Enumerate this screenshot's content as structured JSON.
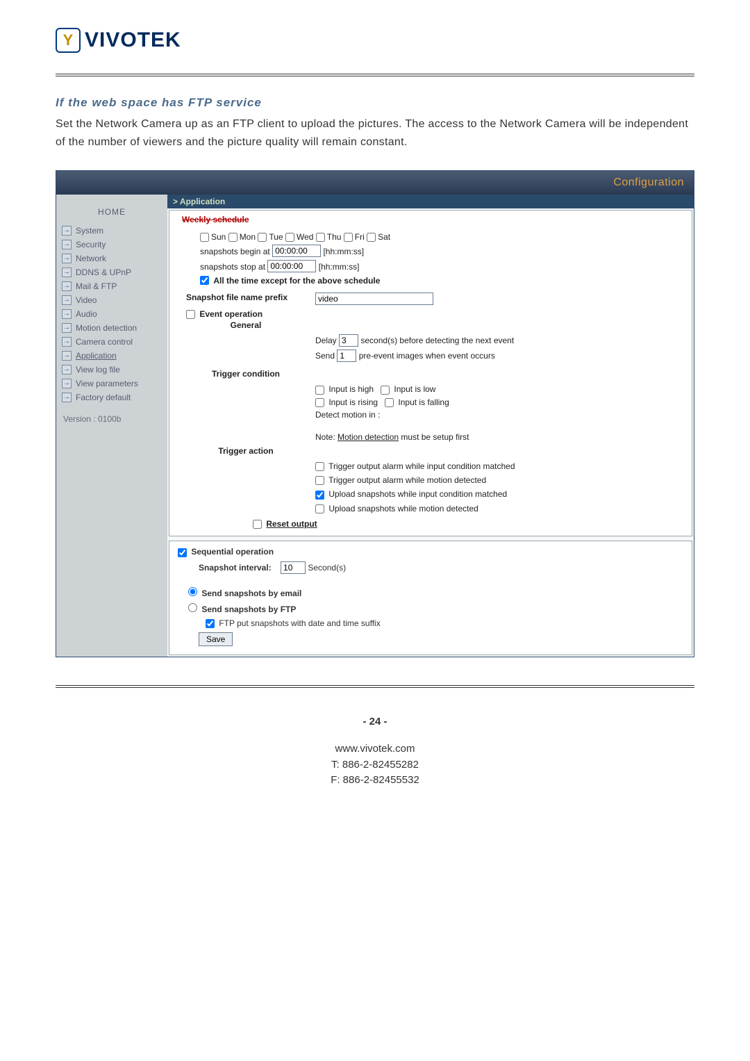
{
  "logo_text": "VIVOTEK",
  "section_title": "If the web space has FTP service",
  "intro": "Set the Network Camera up as an FTP client to upload the pictures. The access to the Network Camera will be independent of the number of viewers and the picture quality will remain constant.",
  "panel_header": "Configuration",
  "sidebar": {
    "home": "HOME",
    "items": [
      "System",
      "Security",
      "Network",
      "DDNS & UPnP",
      "Mail & FTP",
      "Video",
      "Audio",
      "Motion detection",
      "Camera control",
      "Application",
      "View log file",
      "View parameters",
      "Factory default"
    ],
    "active_index": 9,
    "version": "Version : 0100b"
  },
  "breadcrumb": "> Application",
  "schedule": {
    "legend": "Weekly schedule",
    "days": [
      "Sun",
      "Mon",
      "Tue",
      "Wed",
      "Thu",
      "Fri",
      "Sat"
    ],
    "begin_label": "snapshots begin at",
    "begin_value": "00:00:00",
    "stop_label": "snapshots stop at",
    "stop_value": "00:00:00",
    "hint": "[hh:mm:ss]",
    "all_time": "All the time except for the above schedule"
  },
  "prefix": {
    "label": "Snapshot file name prefix",
    "value": "video"
  },
  "event": {
    "label": "Event operation",
    "general": "General",
    "delay_label": "Delay",
    "delay_value": "3",
    "delay_after": "second(s) before detecting the next event",
    "send_label": "Send",
    "send_value": "1",
    "send_after": "pre-event images when event occurs",
    "trigger_cond": "Trigger condition",
    "input_high": "Input is high",
    "input_low": "Input is low",
    "input_rising": "Input is rising",
    "input_falling": "Input is falling",
    "detect_motion": "Detect motion in :",
    "note_pre": "Note: ",
    "note_link": "Motion detection",
    "note_post": " must be setup first",
    "trigger_action": "Trigger action",
    "ta1": "Trigger output alarm while input condition matched",
    "ta2": "Trigger output alarm while motion detected",
    "ta3": "Upload snapshots while input condition matched",
    "ta4": "Upload snapshots while motion detected",
    "reset": "Reset output"
  },
  "seq": {
    "label": "Sequential operation",
    "interval_label": "Snapshot interval:",
    "interval_value": "10",
    "interval_unit": "Second(s)",
    "by_email": "Send snapshots by email",
    "by_ftp": "Send snapshots by FTP",
    "suffix": "FTP put snapshots with date and time suffix",
    "save": "Save"
  },
  "page_number": "- 24 -",
  "footer": {
    "site": "www.vivotek.com",
    "tel": "T: 886-2-82455282",
    "fax": "F: 886-2-82455532"
  }
}
